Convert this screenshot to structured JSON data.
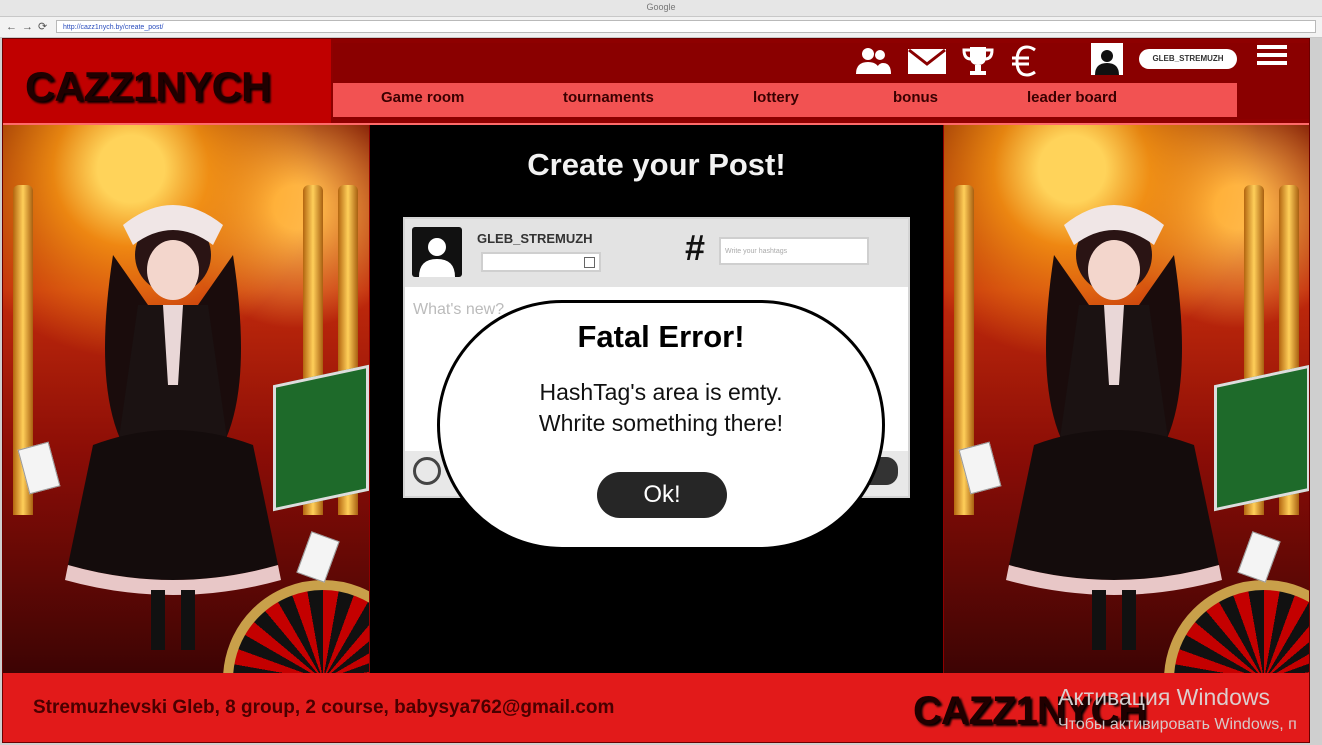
{
  "browser": {
    "title": "Google",
    "nav": [
      "←",
      "→",
      "⟳"
    ],
    "url": "http://cazz1nych.by/create_post/"
  },
  "site": {
    "logo": "CAZZ1NYCH",
    "header_icons": [
      "users-icon",
      "mail-icon",
      "trophy-icon",
      "euro-icon"
    ],
    "user_pill": "GLEB_STREMUZH",
    "menu": [
      "Game room",
      "tournaments",
      "lottery",
      "bonus",
      "leader board"
    ]
  },
  "post": {
    "heading": "Create your Post!",
    "username": "GLEB_STREMUZH",
    "hashtag_symbol": "#",
    "hashtag_placeholder": "Write your hashtags",
    "textarea_placeholder": "What's new?"
  },
  "modal": {
    "title": "Fatal Error!",
    "message_line1": "HashTag's area is emty.",
    "message_line2": "Whrite something there!",
    "ok_label": "Ok!"
  },
  "footer": {
    "credits": "Stremuzhevski Gleb, 8 group, 2 course, babysya762@gmail.com",
    "logo": "CAZZ1NYCH"
  },
  "os_watermark": {
    "line1": "Активация Windows",
    "line2": "Чтобы активировать Windows, п"
  },
  "colors": {
    "brand_red": "#c00000",
    "menu_red": "#f25252",
    "footer_red": "#e21a1a"
  }
}
